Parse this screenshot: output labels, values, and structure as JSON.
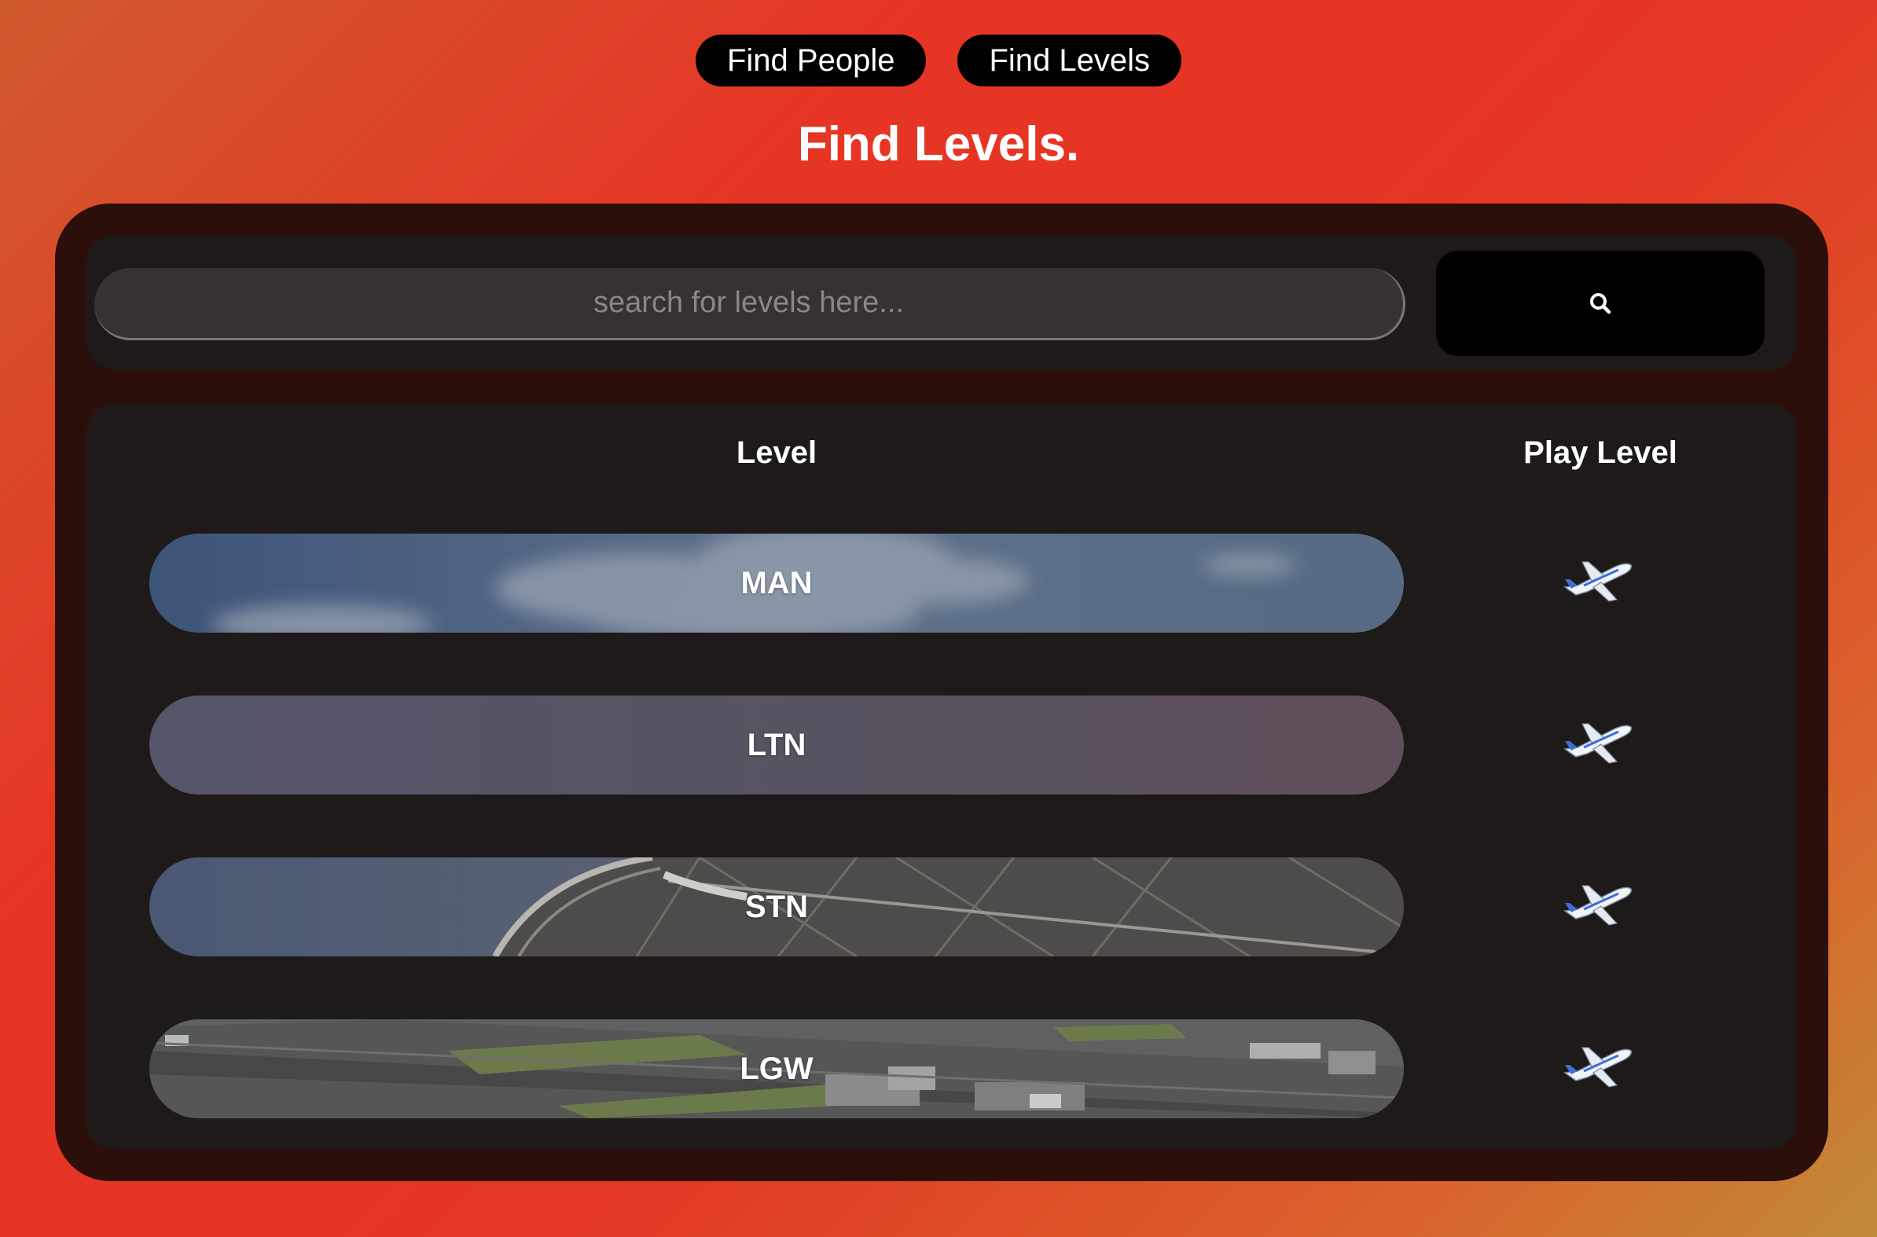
{
  "nav": {
    "find_people": "Find People",
    "find_levels": "Find Levels"
  },
  "page_title": "Find Levels.",
  "search": {
    "placeholder": "search for levels here...",
    "icon": "search-icon"
  },
  "table": {
    "headers": {
      "level": "Level",
      "play": "Play Level"
    },
    "rows": [
      {
        "code": "MAN",
        "play_icon": "airplane-icon"
      },
      {
        "code": "LTN",
        "play_icon": "airplane-icon"
      },
      {
        "code": "STN",
        "play_icon": "airplane-icon"
      },
      {
        "code": "LGW",
        "play_icon": "airplane-icon"
      }
    ]
  },
  "colors": {
    "accent": "#e63524",
    "panel": "#2c0e0b",
    "card": "#1e1a19"
  }
}
